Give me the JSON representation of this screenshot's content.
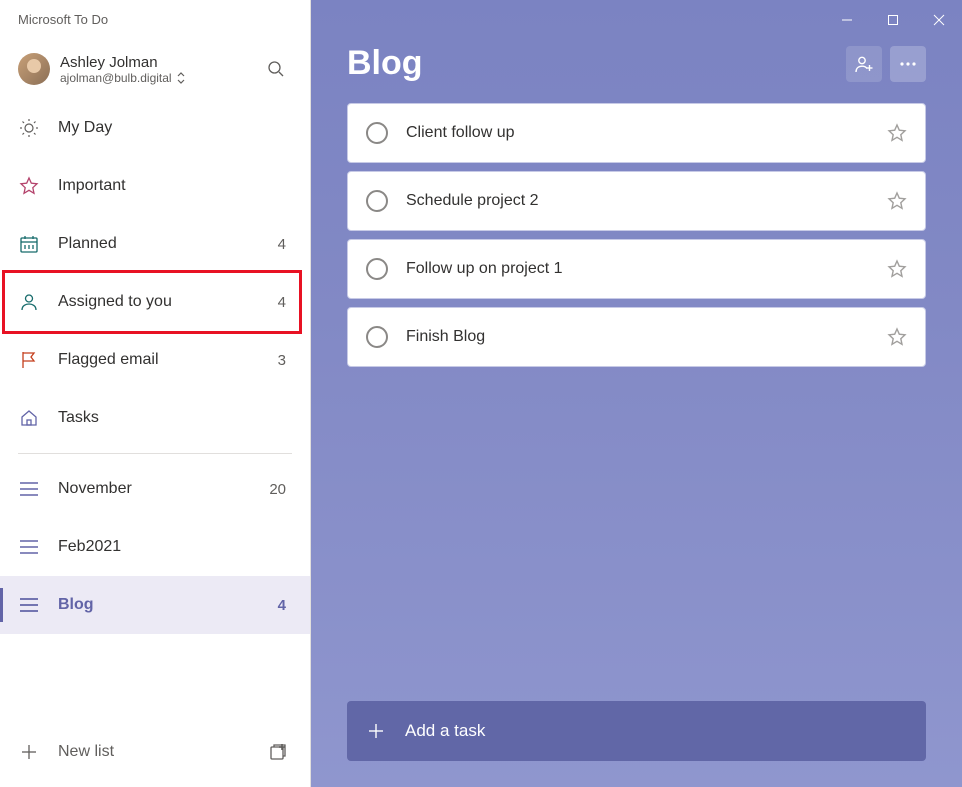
{
  "app_title": "Microsoft To Do",
  "user": {
    "name": "Ashley Jolman",
    "email": "ajolman@bulb.digital"
  },
  "smart_lists": [
    {
      "id": "myday",
      "label": "My Day",
      "count": null,
      "icon": "sun"
    },
    {
      "id": "important",
      "label": "Important",
      "count": null,
      "icon": "star"
    },
    {
      "id": "planned",
      "label": "Planned",
      "count": 4,
      "icon": "calendar"
    },
    {
      "id": "assigned",
      "label": "Assigned to you",
      "count": 4,
      "icon": "person",
      "highlighted": true
    },
    {
      "id": "flagged",
      "label": "Flagged email",
      "count": 3,
      "icon": "flag"
    },
    {
      "id": "tasks",
      "label": "Tasks",
      "count": null,
      "icon": "home"
    }
  ],
  "user_lists": [
    {
      "id": "nov",
      "label": "November",
      "count": 20
    },
    {
      "id": "feb",
      "label": "Feb2021",
      "count": null
    },
    {
      "id": "blog",
      "label": "Blog",
      "count": 4,
      "selected": true
    }
  ],
  "new_list_label": "New list",
  "page": {
    "title": "Blog",
    "tasks": [
      {
        "title": "Client follow up"
      },
      {
        "title": "Schedule project 2"
      },
      {
        "title": "Follow up on project 1"
      },
      {
        "title": "Finish Blog"
      }
    ],
    "add_task_placeholder": "Add a task"
  }
}
